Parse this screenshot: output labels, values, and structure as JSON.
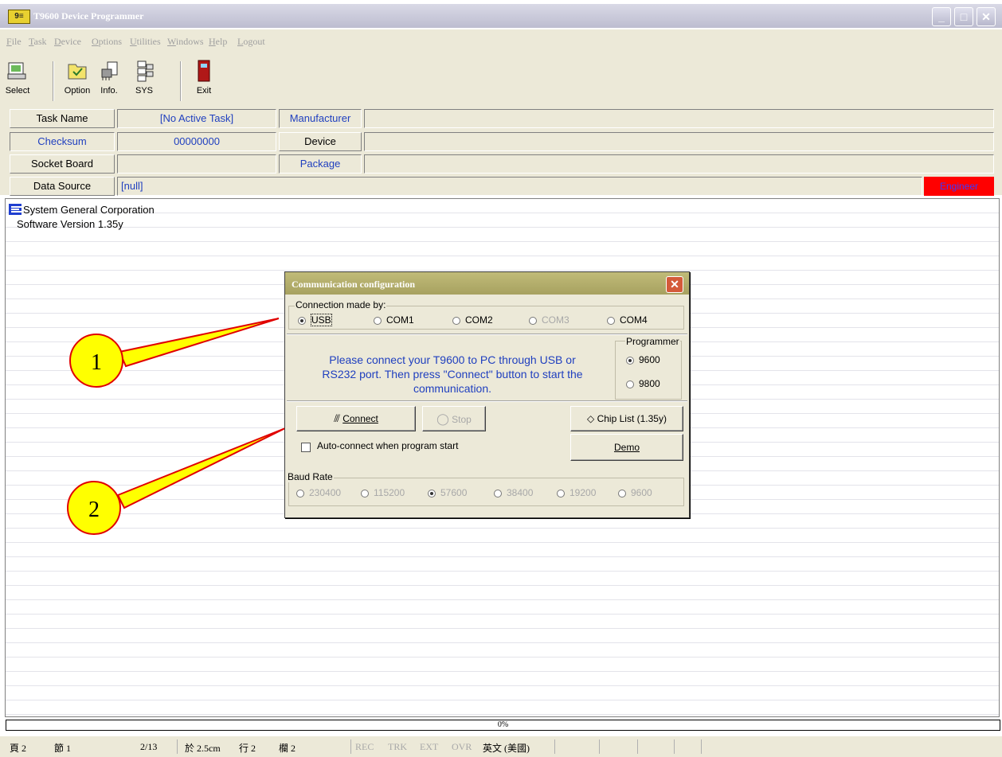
{
  "window": {
    "title": "T9600 Device Programmer",
    "icon_text": "9≡"
  },
  "menu": [
    "File",
    "Task",
    "Device",
    "Options",
    "Utilities",
    "Windows",
    "Help",
    "Logout"
  ],
  "toolbar": [
    {
      "label": "Select",
      "icon": "select-icon"
    },
    {
      "label": "Option",
      "icon": "option-icon"
    },
    {
      "label": "Info.",
      "icon": "info-icon"
    },
    {
      "label": "SYS",
      "icon": "sys-icon"
    },
    {
      "label": "Exit",
      "icon": "exit-icon"
    }
  ],
  "info": {
    "task_name_label": "Task Name",
    "task_name_value": "[No Active Task]",
    "manufacturer_label": "Manufacturer",
    "checksum_label": "Checksum",
    "checksum_value": "00000000",
    "device_label": "Device",
    "socket_board_label": "Socket Board",
    "package_label": "Package",
    "data_source_label": "Data Source",
    "data_source_value": "[null]",
    "mode_badge": "Engineer"
  },
  "content": {
    "company": "System General Corporation",
    "version": "Software Version 1.35y"
  },
  "dialog": {
    "title": "Communication configuration",
    "connection_group": "Connection made by:",
    "connections": [
      {
        "label": "USB",
        "selected": true,
        "enabled": true
      },
      {
        "label": "COM1",
        "selected": false,
        "enabled": true
      },
      {
        "label": "COM2",
        "selected": false,
        "enabled": true
      },
      {
        "label": "COM3",
        "selected": false,
        "enabled": false
      },
      {
        "label": "COM4",
        "selected": false,
        "enabled": true
      }
    ],
    "message": "Please connect your T9600 to PC through USB or RS232 port. Then press \"Connect\" button to start the communication.",
    "programmer_group": "Programmer",
    "programmers": [
      {
        "label": "9600",
        "selected": true
      },
      {
        "label": "9800",
        "selected": false
      }
    ],
    "connect_button": "Connect",
    "stop_button": "Stop",
    "chip_list_button": "Chip List (1.35y)",
    "demo_button": "Demo",
    "auto_connect_label": "Auto-connect when program start",
    "baud_group": "Baud Rate",
    "baud_rates": [
      {
        "label": "230400",
        "selected": false
      },
      {
        "label": "115200",
        "selected": false
      },
      {
        "label": "57600",
        "selected": true
      },
      {
        "label": "38400",
        "selected": false
      },
      {
        "label": "19200",
        "selected": false
      },
      {
        "label": "9600",
        "selected": false
      }
    ]
  },
  "callouts": [
    "1",
    "2"
  ],
  "progress": {
    "text": "0%"
  },
  "status": {
    "page": "頁 2",
    "section": "節 1",
    "pages": "2/13",
    "at": "於 2.5cm",
    "line": "行 2",
    "col": "欄 2",
    "rec": "REC",
    "trk": "TRK",
    "ext": "EXT",
    "ovr": "OVR",
    "lang": "英文 (美國)"
  },
  "colors": {
    "engineer_badge": "#ff0000",
    "label_blue": "#1f3fbf",
    "callout_fill": "#ffff00",
    "callout_stroke": "#e00000"
  }
}
